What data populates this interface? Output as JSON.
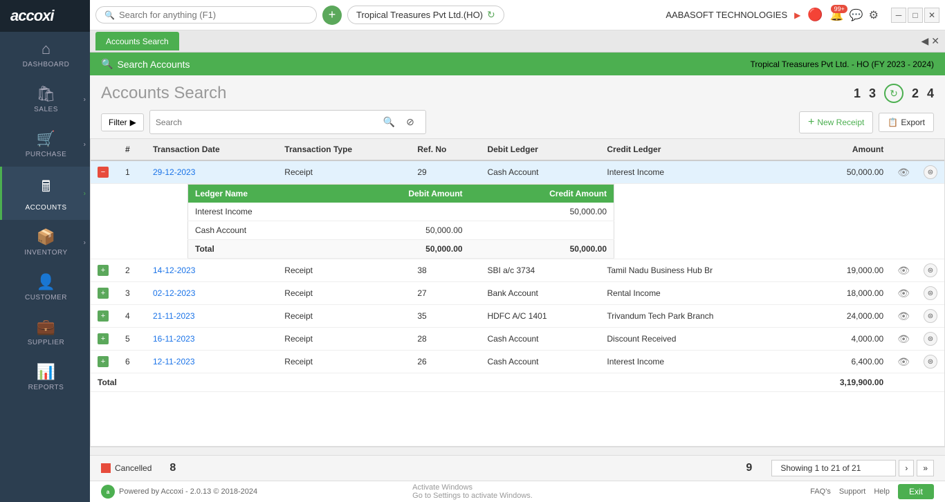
{
  "app": {
    "logo": "accoxi",
    "search_placeholder": "Search for anything (F1)"
  },
  "topbar": {
    "company": "Tropical Treasures Pvt Ltd.(HO)",
    "company_full": "AABASOFT TECHNOLOGIES",
    "badge_count": "99+"
  },
  "sidebar": {
    "items": [
      {
        "id": "dashboard",
        "label": "DASHBOARD",
        "icon": "⌂"
      },
      {
        "id": "sales",
        "label": "SALES",
        "icon": "🛍"
      },
      {
        "id": "purchase",
        "label": "PURCHASE",
        "icon": "🛒"
      },
      {
        "id": "accounts",
        "label": "ACCOUNTS",
        "icon": "🖩"
      },
      {
        "id": "inventory",
        "label": "INVENTORY",
        "icon": "📦"
      },
      {
        "id": "customer",
        "label": "CUSTOMER",
        "icon": "👤"
      },
      {
        "id": "supplier",
        "label": "SUPPLIER",
        "icon": "💼"
      },
      {
        "id": "reports",
        "label": "REPORTS",
        "icon": "📊"
      }
    ]
  },
  "tab": {
    "label": "Accounts Search"
  },
  "green_header": {
    "icon": "🔍",
    "title": "Search Accounts",
    "company_info": "Tropical Treasures Pvt Ltd. - HO (FY 2023 - 2024)"
  },
  "page": {
    "title": "Accounts Search",
    "num1": "1",
    "num2": "2",
    "num3": "3",
    "num4": "4"
  },
  "filter": {
    "button_label": "Filter",
    "search_placeholder": "Search",
    "new_receipt_label": "New Receipt",
    "export_label": "Export"
  },
  "table": {
    "headers": [
      "#",
      "Transaction Date",
      "Transaction Type",
      "Ref. No",
      "Debit Ledger",
      "Credit Ledger",
      "Amount",
      "",
      ""
    ],
    "rows": [
      {
        "num": "1",
        "date": "29-12-2023",
        "type": "Receipt",
        "ref": "29",
        "debit": "Cash Account",
        "credit": "Interest Income",
        "amount": "50,000.00",
        "expanded": true
      },
      {
        "num": "2",
        "date": "14-12-2023",
        "type": "Receipt",
        "ref": "38",
        "debit": "SBI a/c 3734",
        "credit": "Tamil Nadu Business Hub Br",
        "amount": "19,000.00",
        "expanded": false
      },
      {
        "num": "3",
        "date": "02-12-2023",
        "type": "Receipt",
        "ref": "27",
        "debit": "Bank Account",
        "credit": "Rental Income",
        "amount": "18,000.00",
        "expanded": false
      },
      {
        "num": "4",
        "date": "21-11-2023",
        "type": "Receipt",
        "ref": "35",
        "debit": "HDFC A/C 1401",
        "credit": "Trivandum Tech Park Branch",
        "amount": "24,000.00",
        "expanded": false
      },
      {
        "num": "5",
        "date": "16-11-2023",
        "type": "Receipt",
        "ref": "28",
        "debit": "Cash Account",
        "credit": "Discount Received",
        "amount": "4,000.00",
        "expanded": false
      },
      {
        "num": "6",
        "date": "12-11-2023",
        "type": "Receipt",
        "ref": "26",
        "debit": "Cash Account",
        "credit": "Interest Income",
        "amount": "6,400.00",
        "expanded": false
      }
    ],
    "sub_headers": [
      "Ledger Name",
      "Debit Amount",
      "Credit Amount"
    ],
    "sub_rows": [
      {
        "ledger": "Interest Income",
        "debit": "",
        "credit": "50,000.00"
      },
      {
        "ledger": "Cash Account",
        "debit": "50,000.00",
        "credit": ""
      }
    ],
    "sub_total": {
      "label": "Total",
      "debit": "50,000.00",
      "credit": "50,000.00"
    },
    "footer_total": "3,19,900.00"
  },
  "footer": {
    "cancelled_label": "Cancelled",
    "page_info": "Showing 1 to 21 of 21",
    "label8": "8",
    "label9": "9"
  },
  "bottom_bar": {
    "powered_by": "Powered by Accoxi - 2.0.13 © 2018-2024",
    "faq": "FAQ's",
    "support": "Support",
    "help": "Help",
    "exit": "Exit",
    "activate_windows": "Activate Windows",
    "activate_msg": "Go to Settings to activate Windows."
  }
}
